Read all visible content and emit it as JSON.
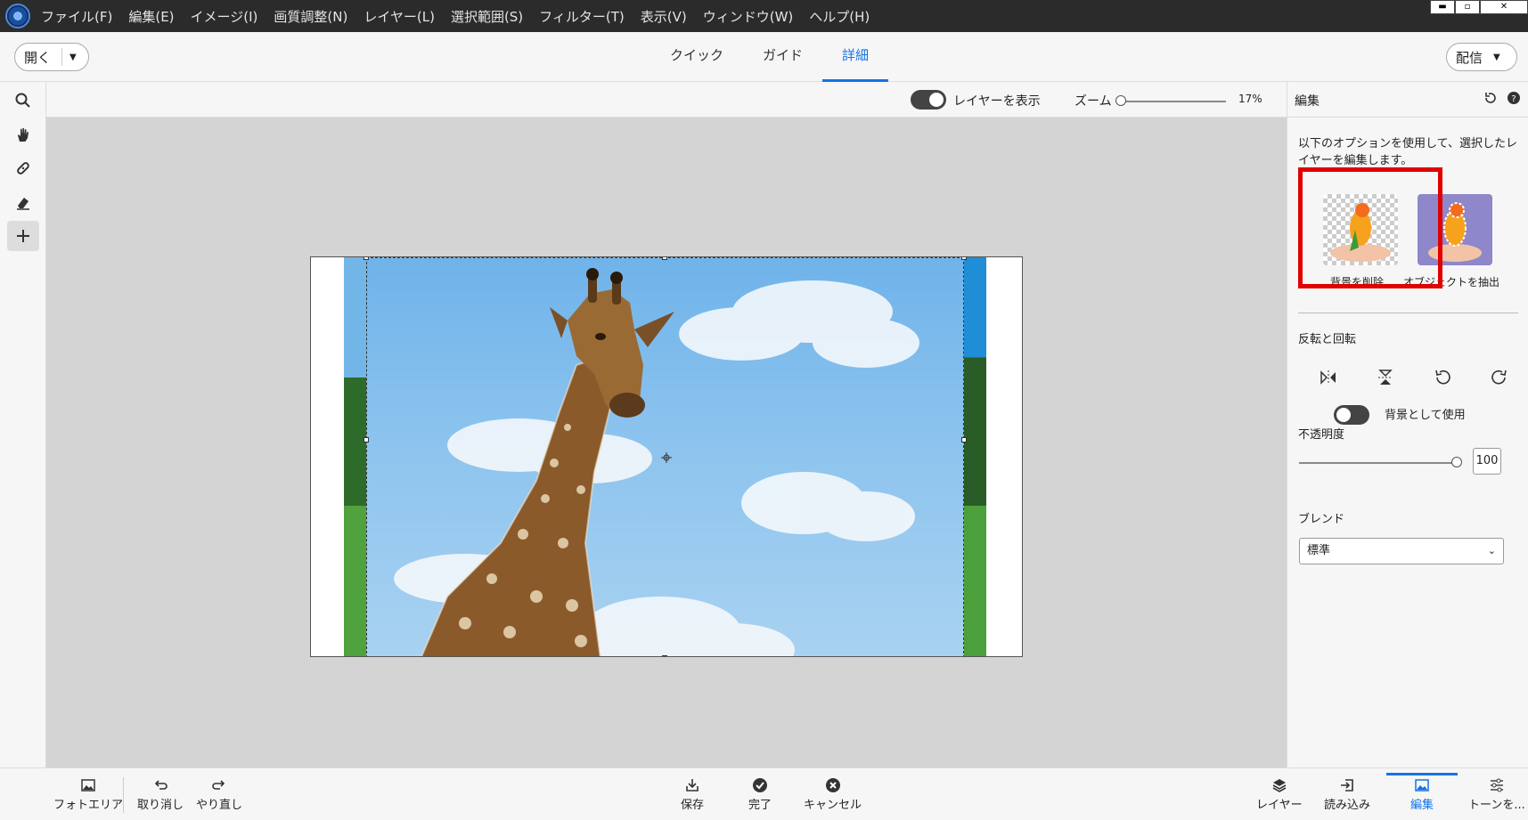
{
  "menu": {
    "items": [
      "ファイル(F)",
      "編集(E)",
      "イメージ(I)",
      "画質調整(N)",
      "レイヤー(L)",
      "選択範囲(S)",
      "フィルター(T)",
      "表示(V)",
      "ウィンドウ(W)",
      "ヘルプ(H)"
    ]
  },
  "topbar": {
    "open_label": "開く",
    "modes": [
      "クイック",
      "ガイド",
      "詳細"
    ],
    "active_mode": "詳細",
    "share_label": "配信"
  },
  "options": {
    "show_layers_label": "レイヤーを表示",
    "zoom_label": "ズーム",
    "zoom_value": "17%"
  },
  "panel": {
    "title": "編集",
    "description": "以下のオプションを使用して、選択したレイヤーを編集します。",
    "remove_bg_label": "背景を削除",
    "extract_object_label": "オブジェクトを抽出",
    "flip_rotate_label": "反転と回転",
    "use_as_bg_label": "背景として使用",
    "opacity_label": "不透明度",
    "opacity_value": "100",
    "blend_label": "ブレンド",
    "blend_value": "標準"
  },
  "bottombar": {
    "photo_bin": "フォトエリア",
    "undo": "取り消し",
    "redo": "やり直し",
    "save": "保存",
    "done": "完了",
    "cancel": "キャンセル",
    "layers": "レイヤー",
    "import": "読み込み",
    "edit": "編集",
    "tone": "トーンを..."
  },
  "colors": {
    "accent": "#1473e6",
    "highlight": "#e00000"
  }
}
